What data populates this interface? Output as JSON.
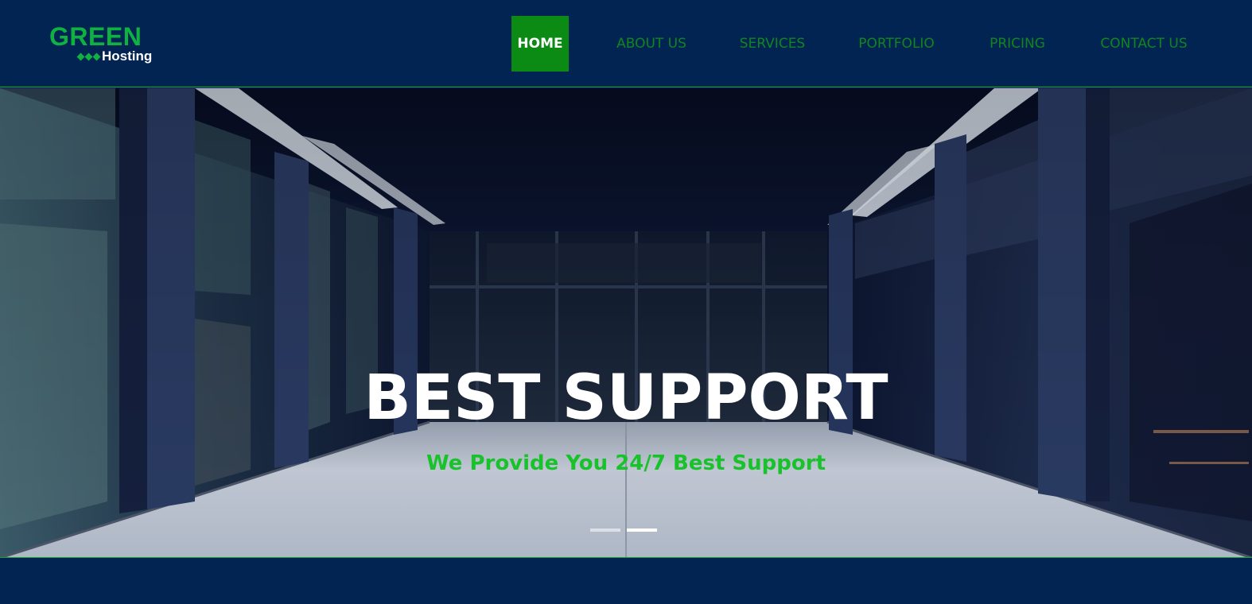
{
  "logo": {
    "word": "GREEN",
    "sub": "Hosting"
  },
  "nav": {
    "items": [
      {
        "label": "HOME",
        "active": true
      },
      {
        "label": "ABOUT US",
        "active": false
      },
      {
        "label": "SERVICES",
        "active": false
      },
      {
        "label": "PORTFOLIO",
        "active": false
      },
      {
        "label": "PRICING",
        "active": false
      },
      {
        "label": "CONTACT US",
        "active": false
      }
    ]
  },
  "hero": {
    "title": "BEST SUPPORT",
    "subtitle": "We Provide You 24/7 Best Support",
    "slides": 2,
    "active_slide": 2
  },
  "colors": {
    "header_bg": "#022453",
    "brand_green": "#0fb240",
    "nav_green": "#11851f",
    "active_bg": "#0b8a14",
    "subtitle_green": "#18c22a"
  }
}
